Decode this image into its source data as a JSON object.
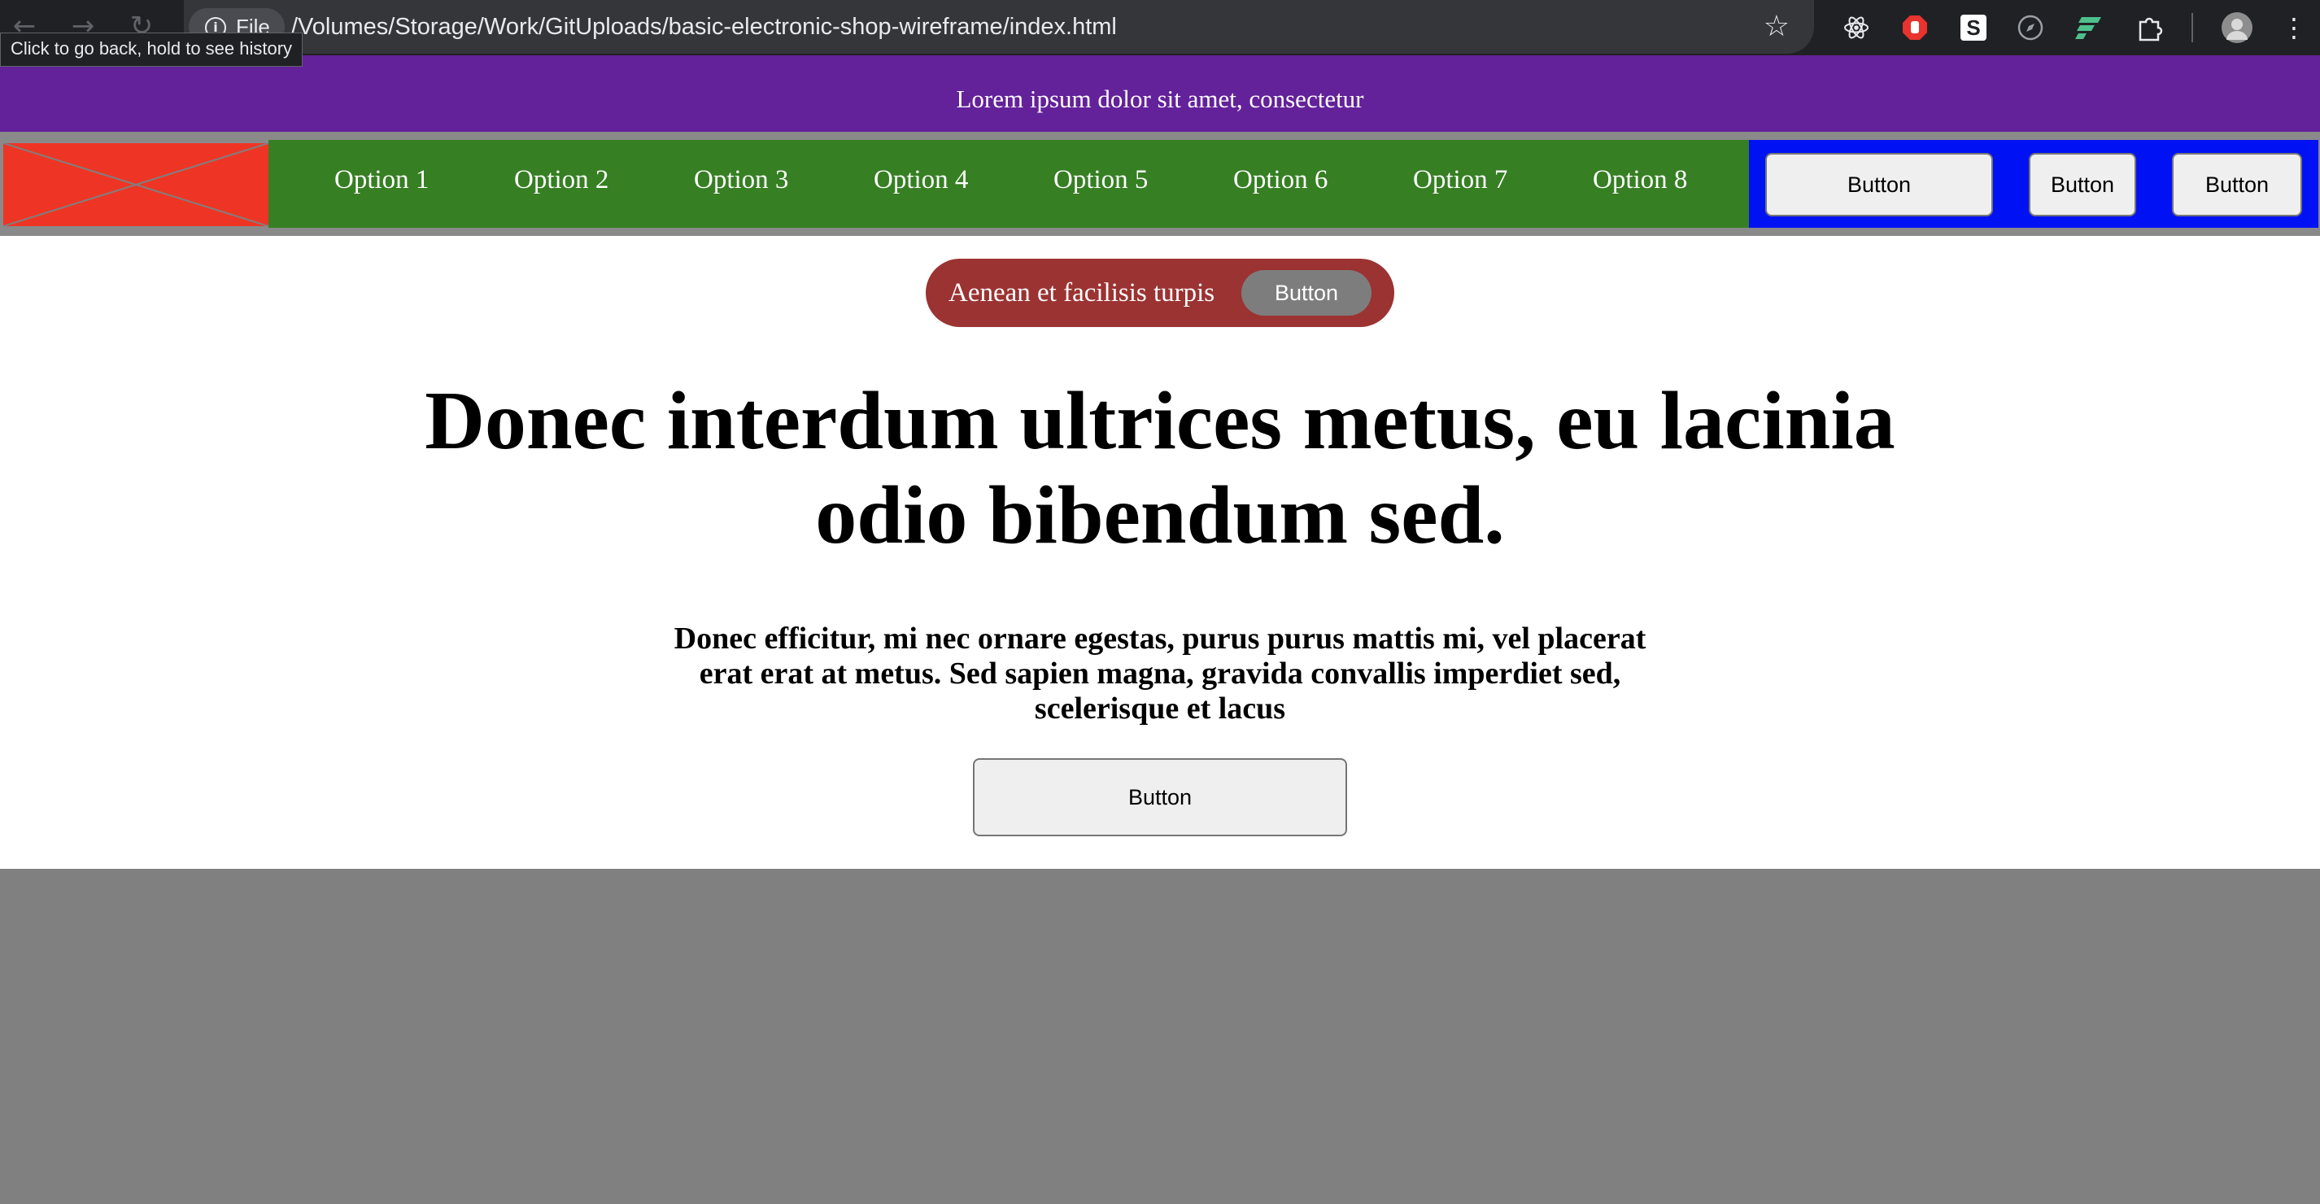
{
  "browser": {
    "back_icon": "←",
    "forward_icon": "→",
    "reload_icon": "↻",
    "scheme_label": "File",
    "url": "/Volumes/Storage/Work/GitUploads/basic-electronic-shop-wireframe/index.html",
    "tooltip": "Click to go back, hold to see history",
    "bookmark_icon": "☆",
    "extensions": [
      "react-icon",
      "stop-icon",
      "s-icon",
      "compass-icon",
      "lines-icon",
      "puzzle-icon"
    ],
    "menu_icon": "⋮"
  },
  "page": {
    "topbar_text": "Lorem ipsum dolor sit amet, consectetur",
    "nav_options": [
      "Option 1",
      "Option 2",
      "Option 3",
      "Option 4",
      "Option 5",
      "Option 6",
      "Option 7",
      "Option 8"
    ],
    "nav_buttons": [
      "Button",
      "Button",
      "Button"
    ],
    "promo_text": "Aenean et facilisis turpis",
    "promo_button": "Button",
    "headline": "Donec interdum ultrices metus, eu lacinia odio bibendum sed.",
    "subtext": "Donec efficitur, mi nec ornare egestas, purus purus mattis mi, vel placerat erat erat at metus. Sed sapien magna, gravida convallis imperdiet sed, scelerisque et lacus",
    "cta_button": "Button"
  },
  "colors": {
    "topbar": "#63219a",
    "logo_placeholder": "#ee3525",
    "menu": "#367f23",
    "button_bar": "#0012f3",
    "promo_pill": "#9b3332",
    "page_background": "#808080"
  }
}
